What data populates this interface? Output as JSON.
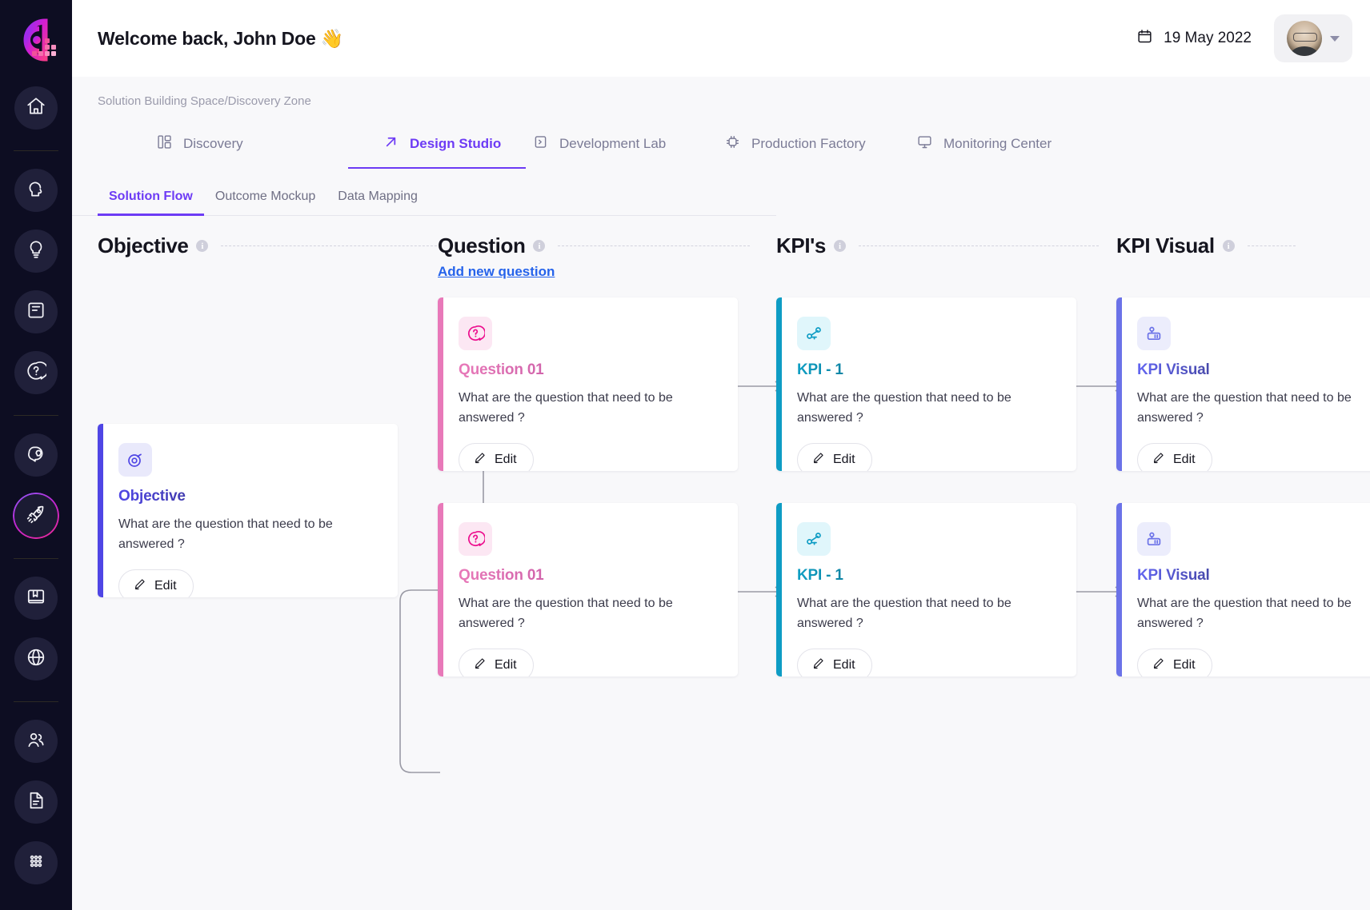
{
  "app": {
    "logo_icon": "brand-d-logo"
  },
  "sidebar": {
    "items": [
      {
        "icon": "home-icon",
        "name": "home",
        "active": false
      },
      {
        "icon": "head-profile-icon",
        "name": "persona",
        "active": false
      },
      {
        "icon": "lightbulb-icon",
        "name": "ideas",
        "active": false
      },
      {
        "icon": "book-icon",
        "name": "library",
        "active": false
      },
      {
        "icon": "question-circle-icon",
        "name": "help",
        "active": false
      },
      {
        "icon": "head-idea-icon",
        "name": "insights",
        "active": false
      },
      {
        "icon": "rocket-icon",
        "name": "launch",
        "active": true
      },
      {
        "icon": "archive-icon",
        "name": "archive",
        "active": false
      },
      {
        "icon": "globe-icon",
        "name": "global",
        "active": false
      },
      {
        "icon": "users-icon",
        "name": "teams",
        "active": false
      },
      {
        "icon": "document-icon",
        "name": "documents",
        "active": false
      },
      {
        "icon": "grid-dots-icon",
        "name": "apps",
        "active": false
      }
    ]
  },
  "header": {
    "welcome": "Welcome back, John Doe 👋",
    "date": "19 May 2022",
    "calendar_icon": "calendar-icon",
    "avatar_icon": "user-avatar",
    "chevron_icon": "chevron-down-icon"
  },
  "breadcrumb": "Solution Building Space/Discovery Zone",
  "main_tabs": [
    {
      "label": "Discovery",
      "icon": "layout-dashboard-icon",
      "active": false
    },
    {
      "label": "Design Studio",
      "icon": "arrow-up-right-icon",
      "active": true
    },
    {
      "label": "Development Lab",
      "icon": "terminal-icon",
      "active": false
    },
    {
      "label": "Production Factory",
      "icon": "cpu-chip-icon",
      "active": false
    },
    {
      "label": "Monitoring Center",
      "icon": "monitor-icon",
      "active": false
    }
  ],
  "sub_tabs": [
    {
      "label": "Solution Flow",
      "active": true
    },
    {
      "label": "Outcome Mockup",
      "active": false
    },
    {
      "label": "Data Mapping",
      "active": false
    }
  ],
  "columns": [
    {
      "title": "Objective",
      "info_icon": "info-icon"
    },
    {
      "title": "Question",
      "info_icon": "info-icon",
      "action_label": "Add new question"
    },
    {
      "title": "KPI's",
      "info_icon": "info-icon"
    },
    {
      "title": "KPI Visual",
      "info_icon": "info-icon"
    }
  ],
  "cards": {
    "objective": {
      "title": "Objective",
      "body": "What are the question that need to be answered ?",
      "edit_label": "Edit",
      "icon": "target-orbit-icon",
      "accent": "#4f46e5",
      "icon_bg": "#e9e9fb"
    },
    "question_1": {
      "title": "Question 01",
      "body": "What are the question that need to be answered ?",
      "edit_label": "Edit",
      "icon": "question-mark-icon",
      "accent": "#e879b9",
      "icon_bg": "#fce7f3"
    },
    "question_2": {
      "title": "Question 01",
      "body": "What are the question that need to be answered ?",
      "edit_label": "Edit",
      "icon": "question-mark-icon",
      "accent": "#e879b9",
      "icon_bg": "#fce7f3"
    },
    "kpi_1": {
      "title": "KPI - 1",
      "body": "What are the question that need to be answered ?",
      "edit_label": "Edit",
      "icon": "key-node-icon",
      "accent": "#0e9cc4",
      "icon_bg": "#e0f6fb"
    },
    "kpi_2": {
      "title": "KPI - 1",
      "body": "What are the question that need to be answered ?",
      "edit_label": "Edit",
      "icon": "key-node-icon",
      "accent": "#0e9cc4",
      "icon_bg": "#e0f6fb"
    },
    "kpivisual_1": {
      "title": "KPI Visual",
      "body": "What are the question that need to be answered ?",
      "edit_label": "Edit",
      "icon": "key-chart-icon",
      "accent": "#6b72e8",
      "icon_bg": "#ecedfc"
    },
    "kpivisual_2": {
      "title": "KPI Visual",
      "body": "What are the question that need to be answered ?",
      "edit_label": "Edit",
      "icon": "key-chart-icon",
      "accent": "#6b72e8",
      "icon_bg": "#ecedfc"
    }
  },
  "edit_icon": "pencil-icon"
}
